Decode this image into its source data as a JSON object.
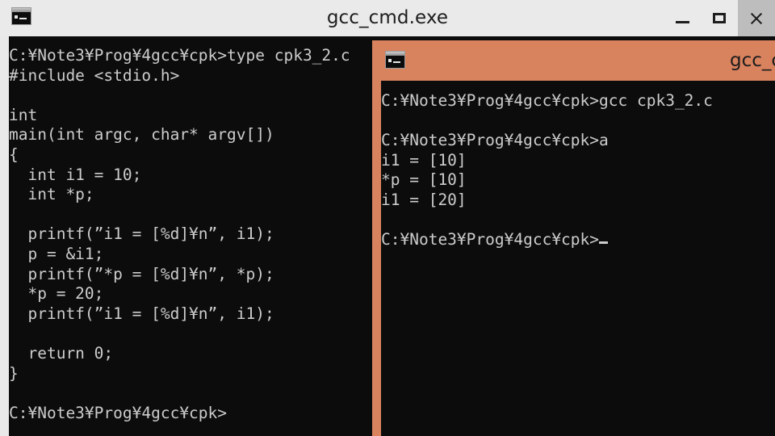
{
  "window_back": {
    "title": "gcc_cmd.exe",
    "icon": "console-icon",
    "controls": {
      "minimize": "–",
      "maximize": "☐",
      "close": "✕"
    },
    "terminal_lines": [
      "C:¥Note3¥Prog¥4gcc¥cpk>type cpk3_2.c",
      "#include <stdio.h>",
      "",
      "int",
      "main(int argc, char* argv[])",
      "{",
      "  int i1 = 10;",
      "  int *p;",
      "",
      "  printf(”i1 = [%d]¥n”, i1);",
      "  p = &i1;",
      "  printf(”*p = [%d]¥n”, *p);",
      "  *p = 20;",
      "  printf(”i1 = [%d]¥n”, i1);",
      "",
      "  return 0;",
      "}",
      "",
      "C:¥Note3¥Prog¥4gcc¥cpk>"
    ]
  },
  "window_front": {
    "title": "gcc_c",
    "icon": "console-icon",
    "terminal_lines": [
      "C:¥Note3¥Prog¥4gcc¥cpk>gcc cpk3_2.c",
      "",
      "C:¥Note3¥Prog¥4gcc¥cpk>a",
      "i1 = [10]",
      "*p = [10]",
      "i1 = [20]",
      "",
      "C:¥Note3¥Prog¥4gcc¥cpk>"
    ],
    "cursor_line_index": 7
  },
  "colors": {
    "desktop": "#e9e9e9",
    "title_inactive": "#eaeaea",
    "title_active": "#d9825e",
    "terminal_bg": "#0c0c0c",
    "terminal_fg": "#cccccc",
    "close_hover": "#bdbdbd"
  }
}
